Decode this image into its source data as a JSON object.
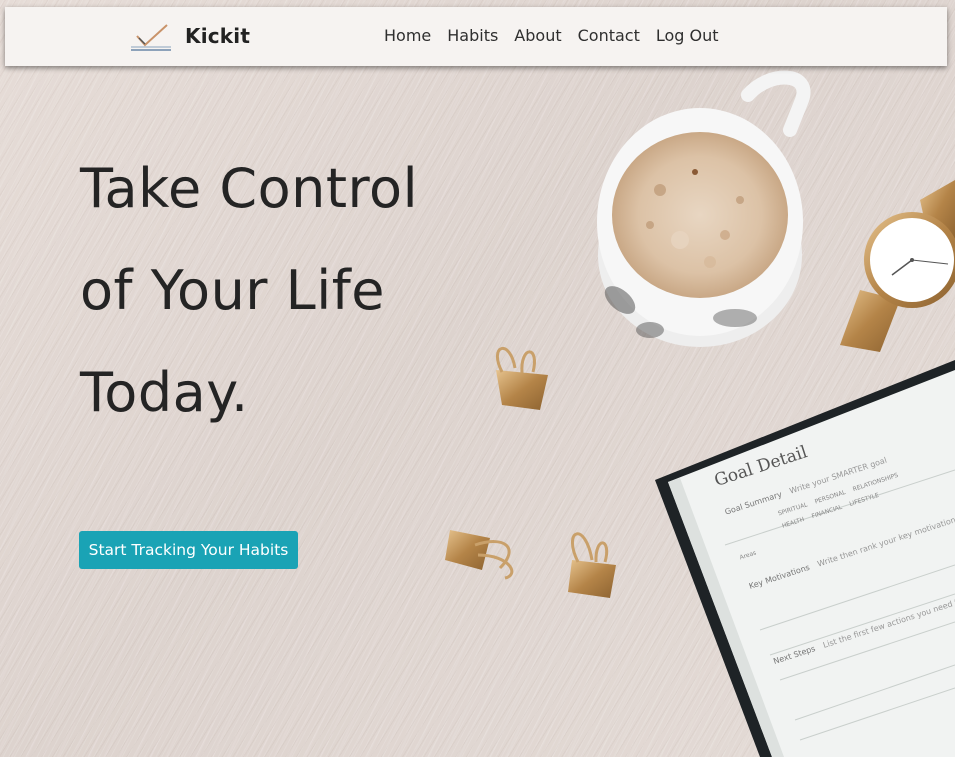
{
  "navbar": {
    "brand": "Kickit",
    "links": [
      "Home",
      "Habits",
      "About",
      "Contact",
      "Log Out"
    ]
  },
  "hero": {
    "title_lines": [
      "Take Control",
      "of Your Life",
      "Today."
    ],
    "cta_label": "Start Tracking Your Habits"
  },
  "notebook": {
    "heading": "Goal Detail",
    "sections": [
      "Goal Summary",
      "Key Motivations",
      "Next Steps"
    ],
    "hints": [
      "Write your SMARTER goal",
      "Write then rank your key motivations",
      "List the first few actions you need to t"
    ],
    "checkbox_labels": [
      "SPIRITUAL",
      "PERSONAL",
      "RELATIONSHIPS",
      "HEALTH",
      "FINANCIAL",
      "LIFESTYLE"
    ],
    "row_label": "Areas"
  },
  "colors": {
    "accent": "#1aa3b5",
    "navbar_bg": "#f6f3f1",
    "text_dark": "#242424"
  }
}
